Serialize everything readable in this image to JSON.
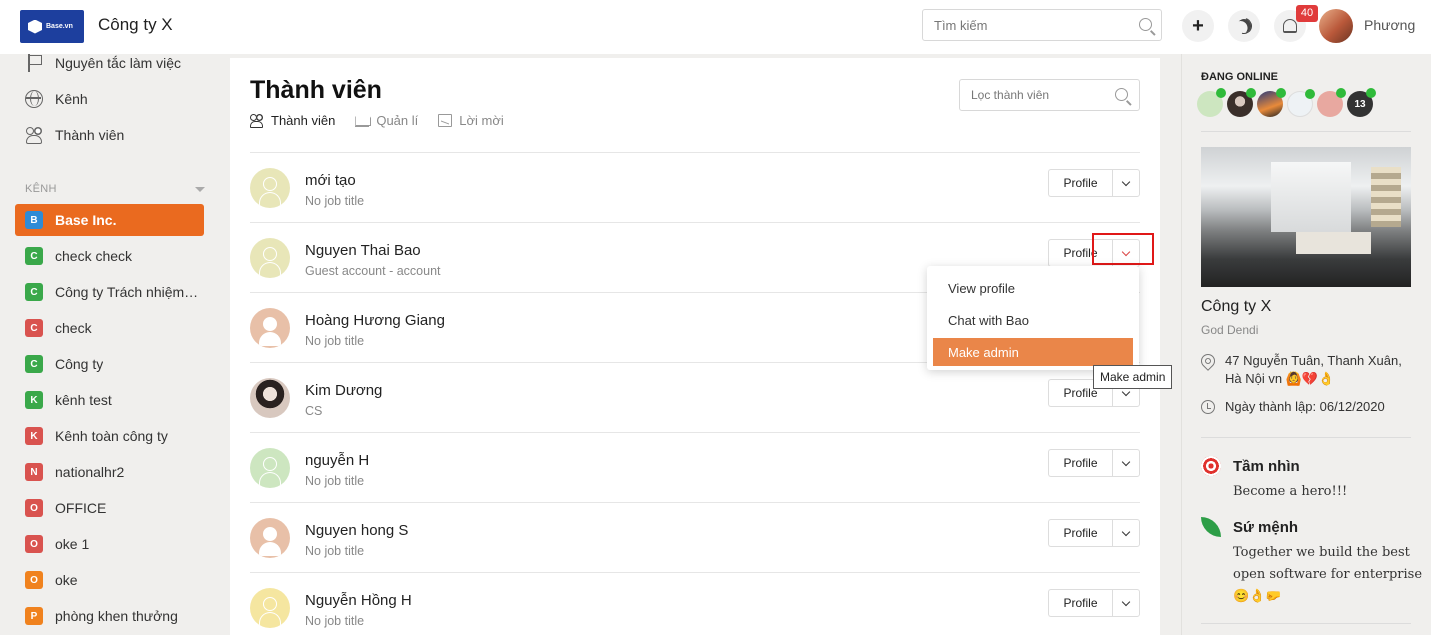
{
  "topbar": {
    "logo_text": "Base.vn",
    "company_name": "Công ty X",
    "search_placeholder": "Tìm kiếm",
    "plus_icon": "+",
    "notification_count": "40",
    "user_name": "Phương"
  },
  "sidebar": {
    "nav": [
      {
        "label": "Nguyên tắc làm việc",
        "icon": "flag-icon"
      },
      {
        "label": "Kênh",
        "icon": "globe-icon"
      },
      {
        "label": "Thành viên",
        "icon": "members-icon"
      }
    ],
    "section_label": "KÊNH",
    "channels": [
      {
        "letter": "B",
        "label": "Base Inc.",
        "color": "#2f8bd6",
        "active": true
      },
      {
        "letter": "C",
        "label": "check check",
        "color": "#3aa84a"
      },
      {
        "letter": "C",
        "label": "Công ty Trách nhiệm hữu hạn",
        "color": "#3aa84a"
      },
      {
        "letter": "C",
        "label": "check",
        "color": "#d9534f"
      },
      {
        "letter": "C",
        "label": "Công ty",
        "color": "#3aa84a"
      },
      {
        "letter": "K",
        "label": "kênh test",
        "color": "#3aa84a"
      },
      {
        "letter": "K",
        "label": "Kênh toàn công ty",
        "color": "#d9534f"
      },
      {
        "letter": "N",
        "label": "nationalhr2",
        "color": "#d9534f"
      },
      {
        "letter": "O",
        "label": "OFFICE",
        "color": "#d9534f"
      },
      {
        "letter": "O",
        "label": "oke 1",
        "color": "#d9534f"
      },
      {
        "letter": "O",
        "label": "oke",
        "color": "#f0821e"
      },
      {
        "letter": "P",
        "label": "phòng khen thưởng",
        "color": "#f0821e"
      }
    ]
  },
  "main": {
    "title": "Thành viên",
    "tabs": [
      {
        "label": "Thành viên",
        "icon": "members-icon",
        "active": true
      },
      {
        "label": "Quản lí",
        "icon": "crown-icon"
      },
      {
        "label": "Lời mời",
        "icon": "invite-icon"
      }
    ],
    "filter_placeholder": "Lọc thành viên",
    "profile_label": "Profile",
    "members": [
      {
        "name": "mới tạo",
        "title": "No job title",
        "avatar_color": "#e8e6b8"
      },
      {
        "name": "Nguyen Thai Bao",
        "title": "Guest account - account",
        "avatar_color": "#e8e6b8"
      },
      {
        "name": "Hoàng Hương Giang",
        "title": "No job title",
        "avatar_color": "#e8c0a8"
      },
      {
        "name": "Kim Dương",
        "title": "CS",
        "avatar_color": "photo"
      },
      {
        "name": "nguyễn H",
        "title": "No job title",
        "avatar_color": "#cde6c0"
      },
      {
        "name": "Nguyen hong S",
        "title": "No job title",
        "avatar_color": "#e8c0a8"
      },
      {
        "name": "Nguyễn Hồng H",
        "title": "No job title",
        "avatar_color": "#f5e6a0"
      }
    ]
  },
  "dropdown": {
    "items": [
      {
        "label": "View profile"
      },
      {
        "label": "Chat with Bao"
      },
      {
        "label": "Make admin",
        "active": true
      }
    ],
    "tooltip": "Make admin"
  },
  "right_panel": {
    "online_label": "ĐANG ONLINE",
    "online_extra_count": "13",
    "company_name": "Công ty X",
    "company_sub": "God Dendi",
    "address": "47 Nguyễn Tuân, Thanh Xuân, Hà Nội vn 🙆💔👌",
    "founded": "Ngày thành lập: 06/12/2020",
    "vision_title": "Tầm nhìn",
    "vision_text": "Become a hero!!!",
    "mission_title": "Sứ mệnh",
    "mission_text": "Together we build the best open software for enterprise 😊👌🤛"
  }
}
